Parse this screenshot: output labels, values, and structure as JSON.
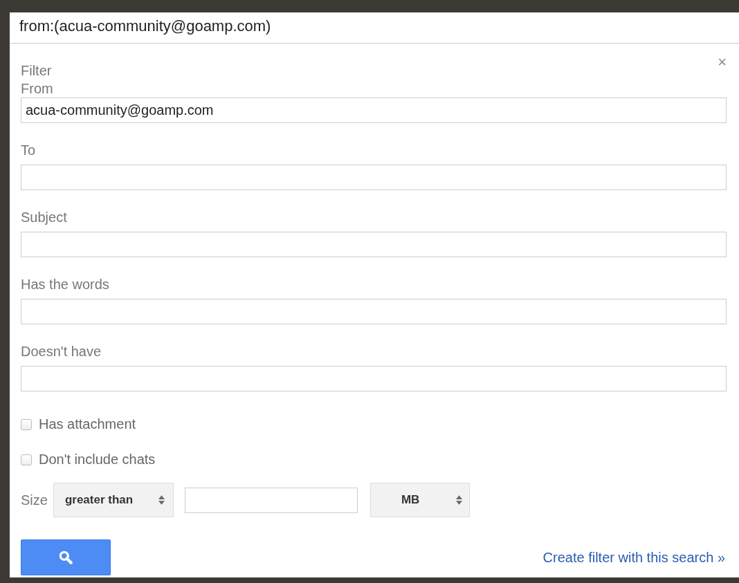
{
  "search_bar": {
    "value": "from:(acua-community@goamp.com)"
  },
  "dialog": {
    "heading": "Filter",
    "close": "×",
    "fields": [
      {
        "label": "From",
        "value": "acua-community@goamp.com"
      },
      {
        "label": "To"
      },
      {
        "label": "Subject"
      },
      {
        "label": "Has the words"
      },
      {
        "label": "Doesn't have"
      }
    ],
    "checkboxes": [
      {
        "label": "Has attachment",
        "checked": false
      },
      {
        "label": "Don't include chats",
        "checked": false
      }
    ],
    "size": {
      "label": "Size",
      "comparison": "greater than",
      "unit": "MB"
    },
    "create_filter_link": "Create filter with this search »"
  }
}
